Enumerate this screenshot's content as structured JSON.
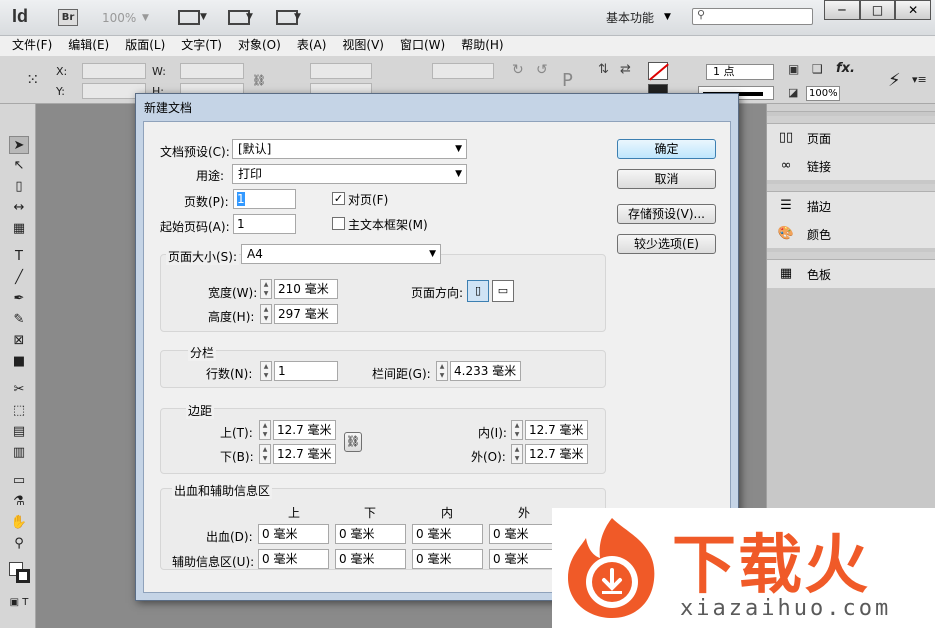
{
  "app": {
    "logo": "Id",
    "bridge_label": "Br",
    "zoom": "100%",
    "workspace": "基本功能",
    "search_placeholder": "",
    "window_controls": [
      "─",
      "□",
      "✕"
    ]
  },
  "menu": [
    "文件(F)",
    "编辑(E)",
    "版面(L)",
    "文字(T)",
    "对象(O)",
    "表(A)",
    "视图(V)",
    "窗口(W)",
    "帮助(H)"
  ],
  "controlbar": {
    "x_label": "X:",
    "y_label": "Y:",
    "w_label": "W:",
    "h_label": "H:",
    "stroke_weight": "1 点",
    "zoom_pct": "100%"
  },
  "panels": [
    {
      "items": [
        {
          "icon": "pages-icon",
          "label": "页面"
        },
        {
          "icon": "links-icon",
          "label": "链接"
        }
      ]
    },
    {
      "items": [
        {
          "icon": "stroke-icon",
          "label": "描边"
        },
        {
          "icon": "color-icon",
          "label": "颜色"
        }
      ]
    },
    {
      "items": [
        {
          "icon": "swatches-icon",
          "label": "色板"
        }
      ]
    }
  ],
  "dialog": {
    "title": "新建文档",
    "preset_label": "文档预设(C):",
    "preset_value": "[默认]",
    "intent_label": "用途:",
    "intent_value": "打印",
    "pages_label": "页数(P):",
    "pages_value": "1",
    "start_label": "起始页码(A):",
    "start_value": "1",
    "facing_label": "对页(F)",
    "facing_checked": true,
    "master_label": "主文本框架(M)",
    "master_checked": false,
    "page_size": {
      "label": "页面大小(S):",
      "value": "A4",
      "width_label": "宽度(W):",
      "width_value": "210 毫米",
      "height_label": "高度(H):",
      "height_value": "297 毫米",
      "orientation_label": "页面方向:"
    },
    "columns": {
      "title": "分栏",
      "count_label": "行数(N):",
      "count_value": "1",
      "gutter_label": "栏间距(G):",
      "gutter_value": "4.233 毫米"
    },
    "margins": {
      "title": "边距",
      "top_label": "上(T):",
      "top_value": "12.7 毫米",
      "bottom_label": "下(B):",
      "bottom_value": "12.7 毫米",
      "inside_label": "内(I):",
      "inside_value": "12.7 毫米",
      "outside_label": "外(O):",
      "outside_value": "12.7 毫米"
    },
    "bleed": {
      "title": "出血和辅助信息区",
      "col_top": "上",
      "col_bottom": "下",
      "col_inside": "内",
      "col_outside": "外",
      "bleed_label": "出血(D):",
      "slug_label": "辅助信息区(U):",
      "bleed_values": [
        "0 毫米",
        "0 毫米",
        "0 毫米",
        "0 毫米"
      ],
      "slug_values": [
        "0 毫米",
        "0 毫米",
        "0 毫米",
        "0 毫米"
      ]
    },
    "buttons": {
      "ok": "确定",
      "cancel": "取消",
      "save_preset": "存储预设(V)...",
      "fewer_options": "较少选项(E)"
    }
  },
  "watermark": {
    "brand": "下载火",
    "url": "xiazaihuo.com"
  }
}
